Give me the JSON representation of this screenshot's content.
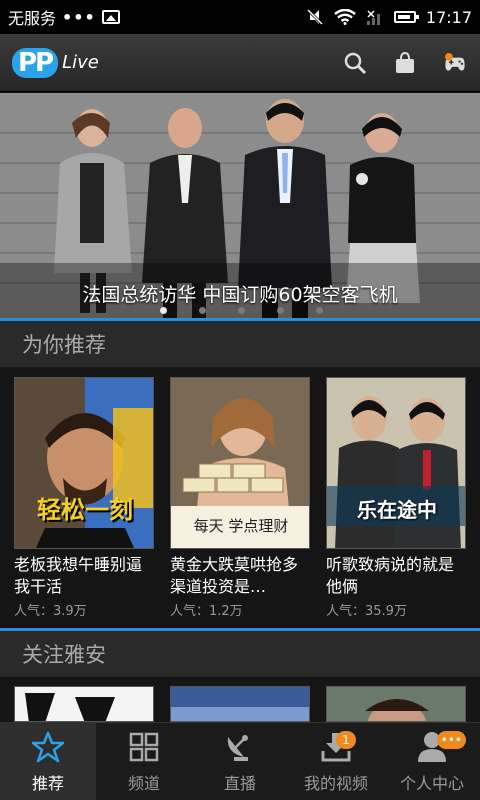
{
  "status_bar": {
    "carrier": "无服务",
    "dots": "•••",
    "time": "17:17"
  },
  "header": {
    "logo_pp": "PP",
    "logo_live": "Live"
  },
  "banner": {
    "title": "法国总统访华 中国订购60架空客飞机",
    "dots_count": 5,
    "active_dot": 0
  },
  "sections": [
    {
      "title": "为你推荐",
      "cards": [
        {
          "title": "老板我想午睡别逼我干活",
          "popularity": "人气：3.9万",
          "overlay_text": "轻松一刻"
        },
        {
          "title": "黄金大跌莫哄抢多渠道投资是…",
          "popularity": "人气：1.2万",
          "overlay_text": "每天 学点理财"
        },
        {
          "title": "听歌致病说的就是他俩",
          "popularity": "人气：35.9万",
          "overlay_text": "乐在途中"
        }
      ]
    },
    {
      "title": "关注雅安",
      "cards": [
        {
          "overlay_text": ""
        },
        {
          "overlay_text": ""
        },
        {
          "overlay_text": ""
        }
      ]
    }
  ],
  "bottom_nav": [
    {
      "label": "推荐",
      "icon": "star-icon",
      "active": true
    },
    {
      "label": "频道",
      "icon": "grid-icon",
      "active": false
    },
    {
      "label": "直播",
      "icon": "satellite-dish-icon",
      "active": false
    },
    {
      "label": "我的视频",
      "icon": "download-icon",
      "active": false,
      "badge": "1"
    },
    {
      "label": "个人中心",
      "icon": "person-icon",
      "active": false,
      "badge": "•••"
    }
  ],
  "colors": {
    "accent": "#2b8fd8",
    "badge": "#f08a1c"
  }
}
